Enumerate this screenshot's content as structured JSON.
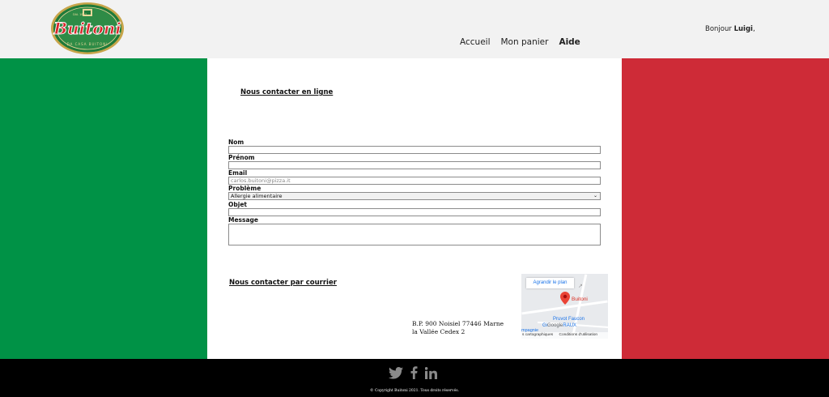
{
  "header": {
    "logo": {
      "brand": "Buitoni",
      "tagline_top": "DAL 1827",
      "tagline_bottom": "DA CASA BUITONI"
    },
    "nav": [
      {
        "label": "Accueil",
        "active": false
      },
      {
        "label": "Mon panier",
        "active": false
      },
      {
        "label": "Aide",
        "active": true
      }
    ],
    "greeting": {
      "prefix": "Bonjour",
      "name": "Luigi",
      "suffix": ","
    }
  },
  "colors": {
    "green": "#009246",
    "white": "#ffffff",
    "red": "#ce2b37",
    "header_bg": "#f2f2f2",
    "footer_bg": "#000000"
  },
  "contact_online": {
    "title": "Nous contacter en ligne",
    "fields": {
      "nom": {
        "label": "Nom",
        "value": ""
      },
      "prenom": {
        "label": "Prénom",
        "value": ""
      },
      "email": {
        "label": "Email",
        "placeholder": "carlos.buitoni@pizza.it"
      },
      "probleme": {
        "label": "Problème",
        "selected": "Allergie alimentaire"
      },
      "objet": {
        "label": "Objet",
        "value": ""
      },
      "message": {
        "label": "Message",
        "value": ""
      }
    }
  },
  "contact_mail": {
    "title": "Nous contacter par courrier",
    "address_line1": "B.P. 900 Noisiel 77446 Marne",
    "address_line2": "la Vallée Cedex 2"
  },
  "map": {
    "enlarge_label": "Agrandir le plan",
    "place": "Buitoni",
    "poi_1": "Pruvot Faucon",
    "poi_2": "Gi",
    "poi_logo": "Google",
    "poi_2_suffix": "RAUX",
    "left_cut": "mpagnie",
    "footer_left": "s cartographiques",
    "footer_right": "Conditions d'utilisation"
  },
  "footer": {
    "socials": [
      "twitter-icon",
      "facebook-icon",
      "linkedin-icon"
    ],
    "copyright": "© Copyright Buitoni 2021. Tous droits réservés."
  }
}
